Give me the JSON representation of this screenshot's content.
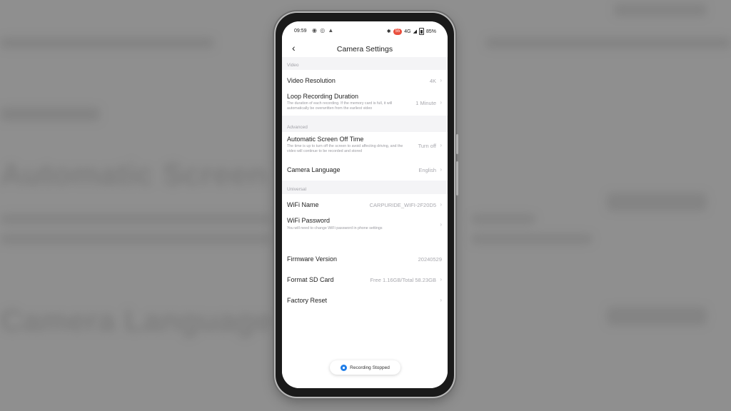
{
  "status": {
    "time": "09:59",
    "left_icons": "◉ ◎ ▲",
    "bluetooth": "✱",
    "badge": "55",
    "network": "4G",
    "signal": "◢",
    "battery": "85%"
  },
  "header": {
    "back_icon": "‹",
    "title": "Camera Settings"
  },
  "sections": {
    "video": "Video",
    "advanced": "Advanced",
    "universal": "Universal"
  },
  "rows": {
    "video_resolution": {
      "label": "Video Resolution",
      "value": "4K"
    },
    "loop_recording": {
      "label": "Loop Recording Duration",
      "desc": "The duration of each recording. If the memory card is full, it will automatically be overwritten from the earliest video",
      "value": "1 Minute"
    },
    "screen_off": {
      "label": "Automatic Screen Off Time",
      "desc": "The time is up to turn off the screen to avoid affecting driving, and the video will continue to be recorded and stored",
      "value": "Turn off"
    },
    "camera_language": {
      "label": "Camera Language",
      "value": "English"
    },
    "wifi_name": {
      "label": "WiFi Name",
      "value": "CARPURIDE_WIFI-2F20D5"
    },
    "wifi_password": {
      "label": "WiFi Password",
      "desc": "You will need to change WiFi password in phone settings"
    },
    "firmware": {
      "label": "Firmware Version",
      "value": "20240529"
    },
    "format_sd": {
      "label": "Format SD Card",
      "value": "Free 1.16GB/Total 58.23GB"
    },
    "factory_reset": {
      "label": "Factory Reset"
    }
  },
  "chevron": "›",
  "toast": {
    "text": "Recording Stopped"
  }
}
